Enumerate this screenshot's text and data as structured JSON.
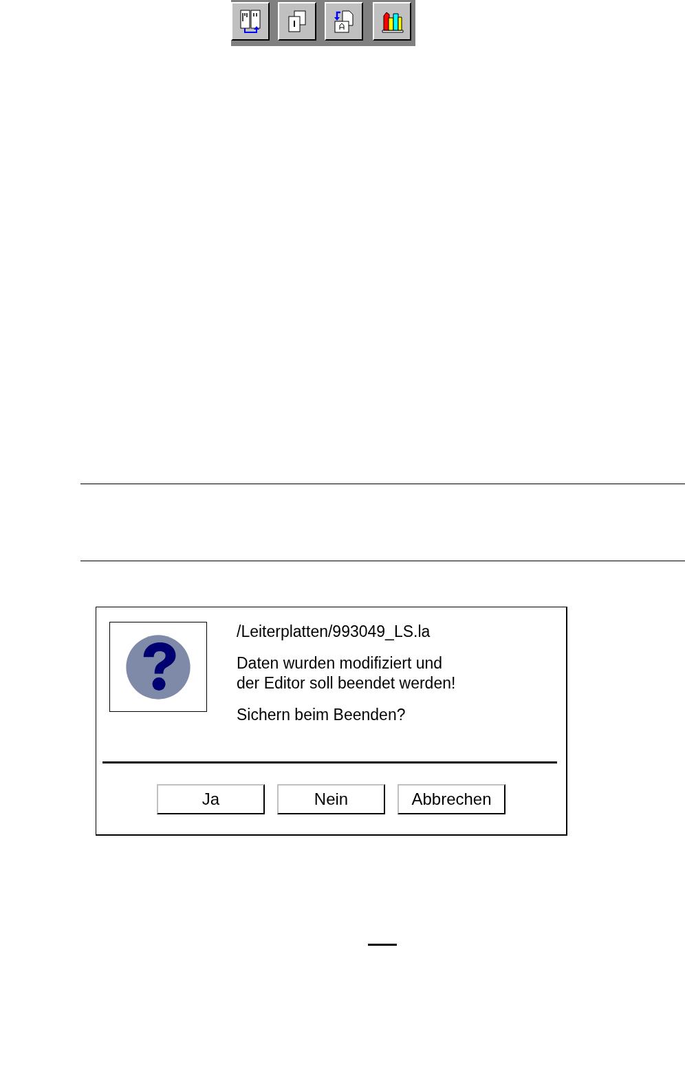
{
  "toolbar": {
    "buttons": [
      {
        "kind": "columns"
      },
      {
        "kind": "pages"
      },
      {
        "kind": "replace"
      },
      {
        "kind": "library"
      }
    ]
  },
  "dialog": {
    "path": "/Leiterplatten/993049_LS.la",
    "message": "Daten wurden modifiziert und\nder Editor soll beendet werden!",
    "question": "Sichern beim Beenden?",
    "buttons": [
      "Ja",
      "Nein",
      "Abbrechen"
    ]
  }
}
